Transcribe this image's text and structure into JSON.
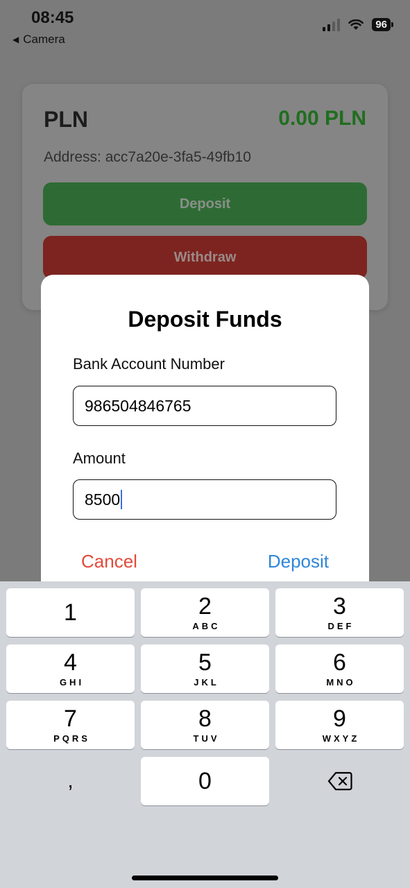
{
  "status_bar": {
    "time": "08:45",
    "back_label": "Camera",
    "battery": "96"
  },
  "account_card": {
    "currency": "PLN",
    "balance": "0.00 PLN",
    "address": "Address: acc7a20e-3fa5-49fb10",
    "deposit_label": "Deposit",
    "withdraw_label": "Withdraw"
  },
  "modal": {
    "title": "Deposit Funds",
    "bank_label": "Bank Account Number",
    "bank_value": "986504846765",
    "amount_label": "Amount",
    "amount_value": "8500",
    "cancel_label": "Cancel",
    "deposit_label": "Deposit"
  },
  "keypad": {
    "keys": [
      {
        "num": "1",
        "letters": ""
      },
      {
        "num": "2",
        "letters": "ABC"
      },
      {
        "num": "3",
        "letters": "DEF"
      },
      {
        "num": "4",
        "letters": "GHI"
      },
      {
        "num": "5",
        "letters": "JKL"
      },
      {
        "num": "6",
        "letters": "MNO"
      },
      {
        "num": "7",
        "letters": "PQRS"
      },
      {
        "num": "8",
        "letters": "TUV"
      },
      {
        "num": "9",
        "letters": "WXYZ"
      },
      {
        "num": ",",
        "letters": ""
      },
      {
        "num": "0",
        "letters": ""
      }
    ]
  },
  "colors": {
    "balance_green": "#1f6e1f",
    "deposit_green": "#2e6b34",
    "withdraw_red": "#7d2420",
    "cancel_red": "#e24a3a",
    "deposit_blue": "#2f86d8"
  }
}
